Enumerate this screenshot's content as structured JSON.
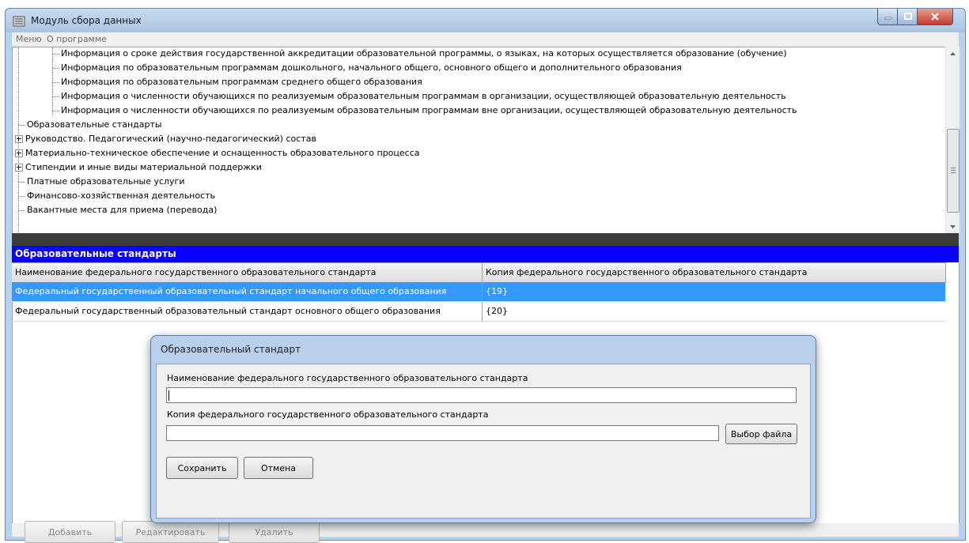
{
  "window": {
    "title": "Модуль сбора данных"
  },
  "menu": [
    {
      "label": "Меню"
    },
    {
      "label": "О программе"
    }
  ],
  "tree": {
    "children": [
      {
        "label": "Информация о сроке действия государственной аккредитации образовательной программы, о языках, на которых осуществляется образование (обучение)"
      },
      {
        "label": "Информация по образовательным программам дошкольного, начального общего, основного общего и дополнительного образования"
      },
      {
        "label": "Информация по образовательным программам среднего общего образования"
      },
      {
        "label": "Информация о численности обучающихся по реализуемым образовательным программам в организации, осуществляющей образовательную деятельность"
      },
      {
        "label": "Информация о численности обучающихся по реализуемым образовательным программам вне организации, осуществляющей образовательную деятельность"
      }
    ],
    "items": [
      {
        "label": "Образовательные стандарты"
      },
      {
        "label": "Руководство. Педагогический (научно-педагогический) состав",
        "expandable": true
      },
      {
        "label": "Материально-техническое обеспечение и оснащенность образовательного процесса",
        "expandable": true
      },
      {
        "label": "Стипендии и иные виды материальной поддержки",
        "expandable": true
      },
      {
        "label": "Платные образовательные услуги"
      },
      {
        "label": "Финансово-хозяйственная деятельность"
      },
      {
        "label": "Вакантные места для приема (перевода)"
      }
    ]
  },
  "section": {
    "title": "Образовательные стандарты"
  },
  "grid": {
    "columns": [
      "Наименование федерального государственного образовательного стандарта",
      "Копия федерального государственного образовательного стандарта"
    ],
    "rows": [
      {
        "name": "Федеральный государственный образовательный стандарт начального общего образования",
        "copy": "{19}",
        "selected": true
      },
      {
        "name": "Федеральный государственный образовательный стандарт основного общего образования",
        "copy": "{20}",
        "selected": false
      }
    ]
  },
  "buttons": {
    "add": "Добавить",
    "edit": "Редактировать",
    "delete": "Удалить"
  },
  "dialog": {
    "title": "Образовательный стандарт",
    "name_label": "Наименование федерального государственного образовательного стандарта",
    "name_value": "",
    "copy_label": "Копия федерального государственного образовательного стандарта",
    "copy_value": "",
    "browse": "Выбор файла",
    "save": "Сохранить",
    "cancel": "Отмена"
  },
  "colors": {
    "section_header": "#0b00ff",
    "selection": "#3399ff",
    "close_button": "#c23c2a"
  }
}
